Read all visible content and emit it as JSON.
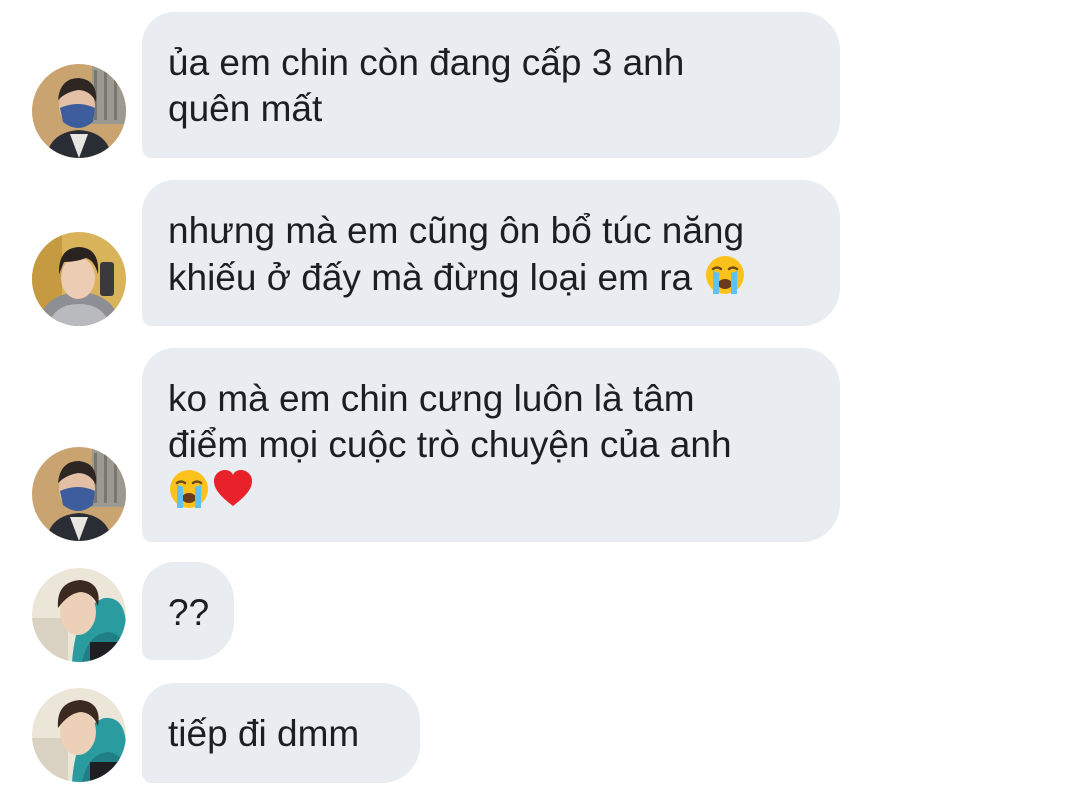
{
  "conversation": {
    "messages": [
      {
        "avatar_icon": "avatar-masked-icon",
        "lines": [
          "ủa em chin còn đang cấp 3 anh",
          "quên mất"
        ],
        "emojis": []
      },
      {
        "avatar_icon": "avatar-hood-icon",
        "lines": [
          "nhưng mà em cũng ôn bổ túc năng",
          "khiếu ở đấy mà đừng loại em ra"
        ],
        "emojis": [
          "loudly-crying-face-icon"
        ]
      },
      {
        "avatar_icon": "avatar-masked-icon",
        "lines": [
          "ko mà em chin cưng luôn là tâm",
          "điểm mọi cuộc trò chuyện của anh"
        ],
        "emojis": [
          "loudly-crying-face-icon",
          "red-heart-icon"
        ]
      },
      {
        "avatar_icon": "avatar-teal-hood-icon",
        "lines": [
          "??"
        ],
        "emojis": []
      },
      {
        "avatar_icon": "avatar-teal-hood-icon",
        "lines": [
          "tiếp đi dmm"
        ],
        "emojis": []
      }
    ]
  },
  "colors": {
    "bubble_background": "#e9ecf1",
    "text": "#1c1e21",
    "page_background": "#ffffff"
  }
}
